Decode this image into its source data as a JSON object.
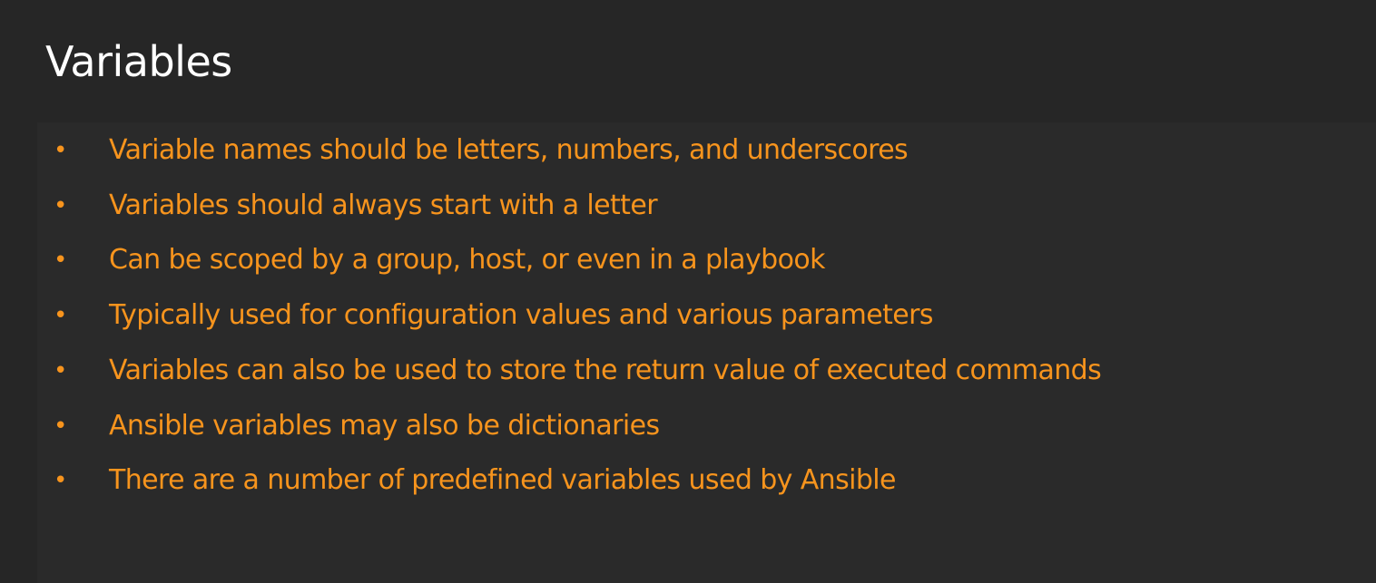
{
  "slide": {
    "title": "Variables",
    "bullets": [
      "Variable names should be letters, numbers, and underscores",
      "Variables should always start with a letter",
      "Can be scoped by a group, host, or even in a playbook",
      "Typically used for configuration values and various parameters",
      "Variables can also be used to store the return value of executed commands",
      "Ansible variables may also be dictionaries",
      "There are a number of predefined variables used by Ansible"
    ],
    "bullet_glyph": "•",
    "colors": {
      "background": "#262626",
      "title": "#ffffff",
      "bullet_text": "#f7941d"
    }
  }
}
